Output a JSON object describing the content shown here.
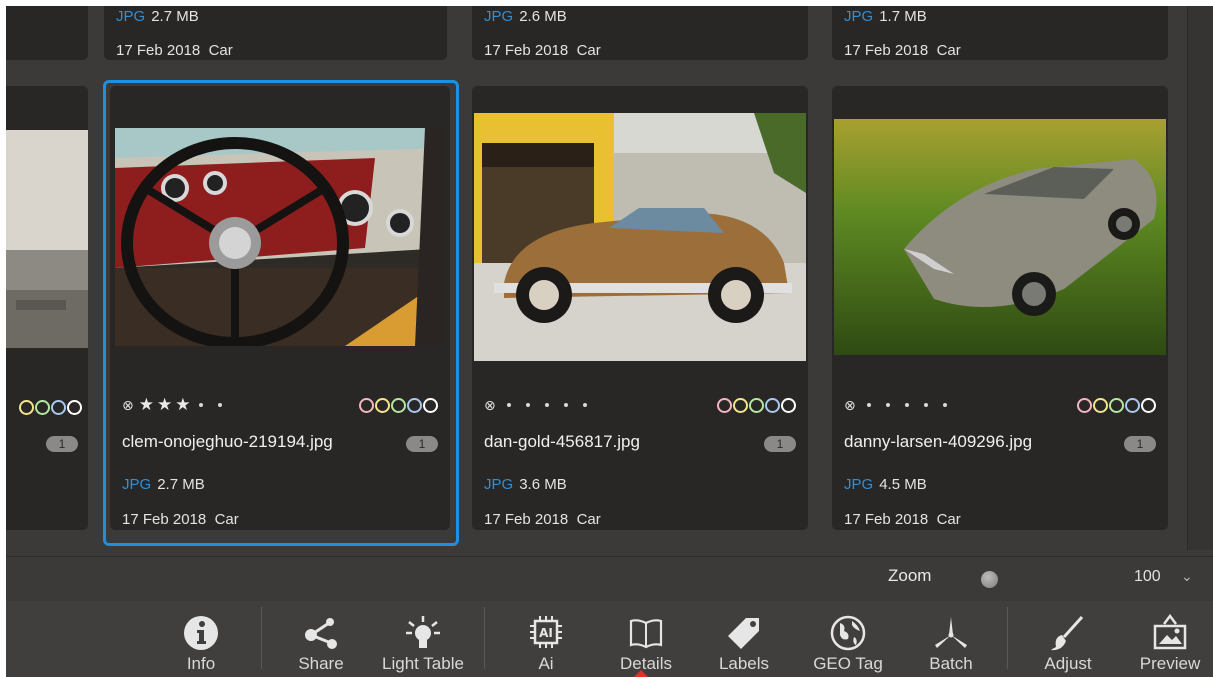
{
  "gallery": {
    "top_row": [
      {
        "type": "JPG",
        "size": "2.7 MB",
        "date": "17 Feb 2018",
        "tag": "Car"
      },
      {
        "type": "JPG",
        "size": "2.6 MB",
        "date": "17 Feb 2018",
        "tag": "Car"
      },
      {
        "type": "JPG",
        "size": "1.7 MB",
        "date": "17 Feb 2018",
        "tag": "Car"
      }
    ],
    "left_partial": {
      "badge": "1"
    },
    "cards": [
      {
        "filename": "clem-onojeghuo-219194.jpg",
        "type": "JPG",
        "size": "2.7 MB",
        "date": "17 Feb 2018",
        "tag": "Car",
        "badge": "1",
        "reject": "⊗",
        "stars": 3,
        "selected": true
      },
      {
        "filename": "dan-gold-456817.jpg",
        "type": "JPG",
        "size": "3.6 MB",
        "date": "17 Feb 2018",
        "tag": "Car",
        "badge": "1",
        "reject": "⊗",
        "stars": 0,
        "selected": false
      },
      {
        "filename": "danny-larsen-409296.jpg",
        "type": "JPG",
        "size": "4.5 MB",
        "date": "17 Feb 2018",
        "tag": "Car",
        "badge": "1",
        "reject": "⊗",
        "stars": 0,
        "selected": false
      }
    ],
    "star_glyph": "★",
    "color_labels": [
      "#f4b6c2",
      "#f3e58c",
      "#b4e8a0",
      "#a9c8f0",
      "#ffffff"
    ],
    "accent_color": "#1f8fe0",
    "filetype_color": "#2f8fd8"
  },
  "zoom": {
    "label": "Zoom",
    "value": "100",
    "chevron": "⌄"
  },
  "toolbar": {
    "items": [
      {
        "label": "Info",
        "icon": "info-icon"
      },
      {
        "label": "Share",
        "icon": "share-icon"
      },
      {
        "label": "Light Table",
        "icon": "light-table-icon"
      },
      {
        "label": "Ai",
        "icon": "ai-chip-icon"
      },
      {
        "label": "Details",
        "icon": "book-icon"
      },
      {
        "label": "Labels",
        "icon": "tag-icon"
      },
      {
        "label": "GEO Tag",
        "icon": "globe-icon"
      },
      {
        "label": "Batch",
        "icon": "fan-icon"
      },
      {
        "label": "Adjust",
        "icon": "brush-icon"
      },
      {
        "label": "Preview",
        "icon": "preview-icon"
      }
    ]
  }
}
